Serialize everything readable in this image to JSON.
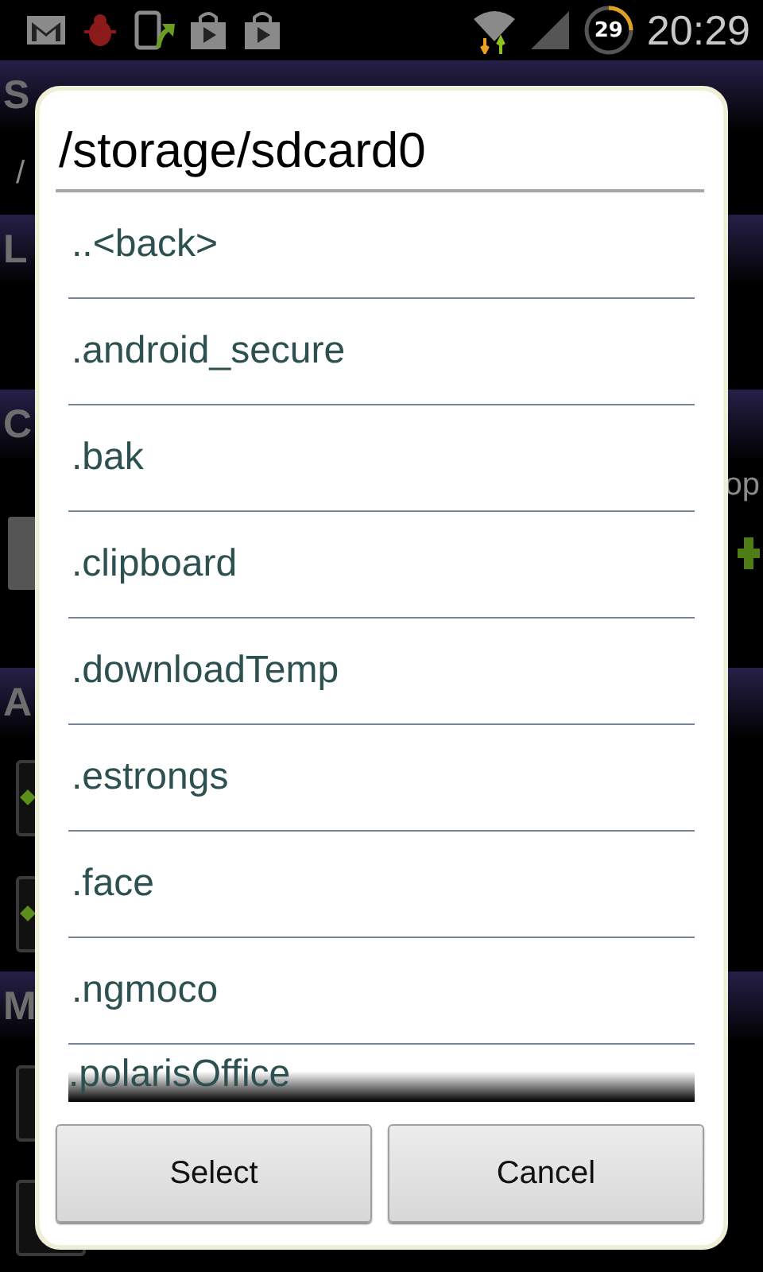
{
  "status_bar": {
    "battery_badge": "29",
    "time": "20:29"
  },
  "background": {
    "headers": [
      "S",
      "L",
      "C",
      "A",
      "M"
    ],
    "path_text": "/",
    "side_text": "op",
    "checkboxes": [
      {
        "checked": true
      },
      {
        "checked": true
      }
    ]
  },
  "dialog": {
    "title": "/storage/sdcard0",
    "items": [
      {
        "label": "..<back>"
      },
      {
        "label": ".android_secure"
      },
      {
        "label": ".bak"
      },
      {
        "label": ".clipboard"
      },
      {
        "label": ".downloadTemp"
      },
      {
        "label": ".estrongs"
      },
      {
        "label": ".face"
      },
      {
        "label": ".ngmoco"
      }
    ],
    "cut_item": ".polarisOffice",
    "buttons": [
      "Select",
      "Cancel"
    ]
  }
}
